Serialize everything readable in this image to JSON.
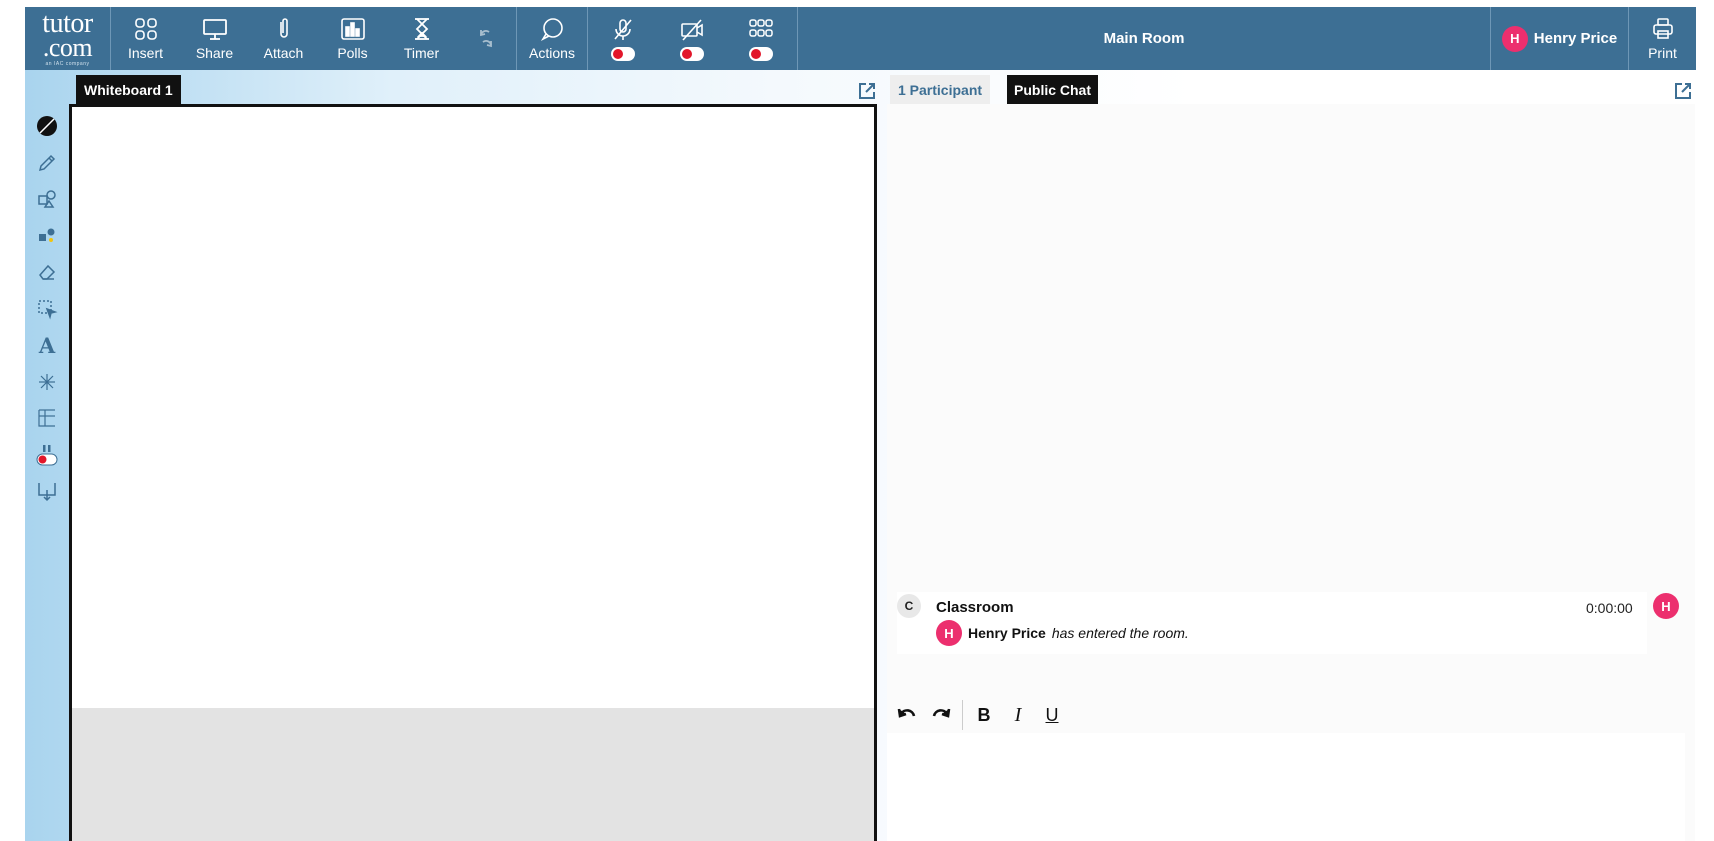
{
  "logo": {
    "line1": "tutor",
    "line2": ".com",
    "line3": "an IAC company"
  },
  "toolbar": {
    "insert": "Insert",
    "share": "Share",
    "attach": "Attach",
    "polls": "Polls",
    "timer": "Timer",
    "actions": "Actions"
  },
  "room": {
    "name": "Main Room"
  },
  "user": {
    "initial": "H",
    "name": "Henry Price"
  },
  "print": {
    "label": "Print"
  },
  "whiteboard": {
    "tab": "Whiteboard 1"
  },
  "chat": {
    "participants_tab": "1 Participant",
    "chat_tab": "Public Chat",
    "message": {
      "sender_initial": "C",
      "sender": "Classroom",
      "time": "0:00:00",
      "user_initial": "H",
      "user_name": "Henry Price",
      "text": "has entered the room.",
      "right_avatar": "H"
    },
    "editor": {
      "bold": "B",
      "italic": "I",
      "underline": "U"
    }
  },
  "colors": {
    "topbar": "#3d6f94",
    "avatar": "#ec2f6e",
    "toggle_off": "#e2162a"
  }
}
